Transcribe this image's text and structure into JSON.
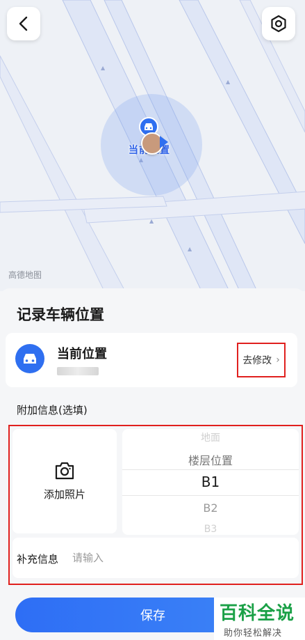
{
  "map": {
    "pin_label": "当前位置",
    "logo_text": "高德地图",
    "back_icon": "chevron-left-icon",
    "settings_icon": "gear-icon"
  },
  "sheet": {
    "title": "记录车辆位置",
    "location": {
      "name": "当前位置",
      "modify_label": "去修改",
      "icon": "car-icon"
    },
    "extra": {
      "title": "附加信息(选填)",
      "photo_label": "添加照片",
      "picker": {
        "items": [
          "地面",
          "楼层位置",
          "B1",
          "B2",
          "B3"
        ],
        "selected": "B1"
      },
      "note_label": "补充信息",
      "note_placeholder": "请输入"
    },
    "save_label": "保存"
  },
  "watermark": {
    "title": "百科全说",
    "subtitle": "助你轻松解决"
  },
  "colors": {
    "accent": "#2f6ff0",
    "highlight_border": "#e0201e",
    "watermark_green": "#1aa046"
  }
}
